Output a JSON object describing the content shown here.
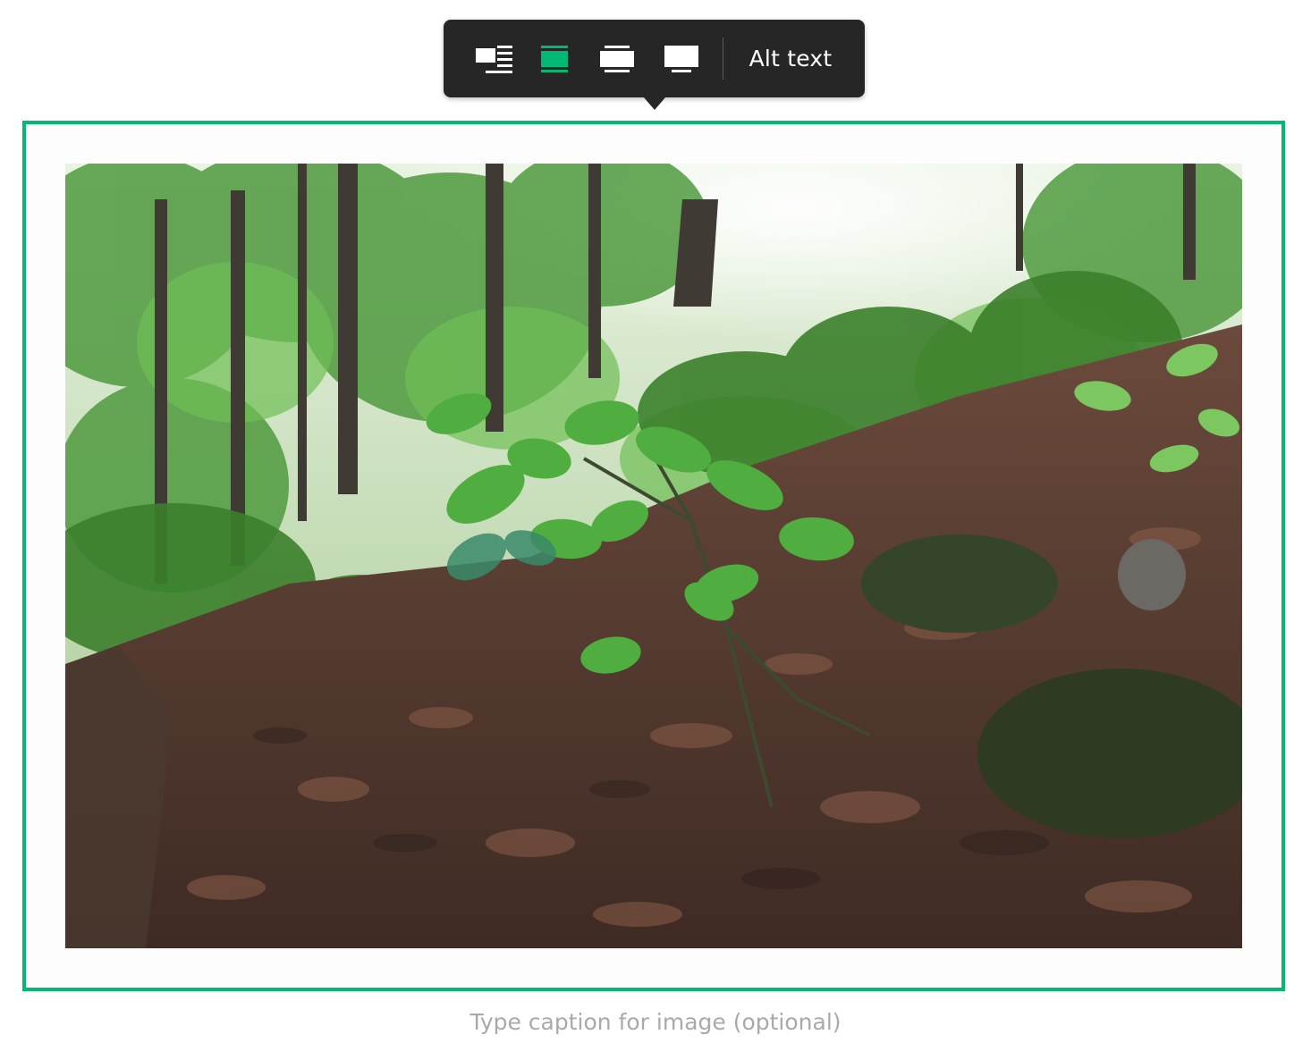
{
  "toolbar": {
    "buttons": [
      {
        "icon": "inset-left-icon",
        "active": false
      },
      {
        "icon": "column-width-icon",
        "active": true
      },
      {
        "icon": "outset-width-icon",
        "active": false
      },
      {
        "icon": "full-width-icon",
        "active": false
      }
    ],
    "alt_text_label": "Alt text"
  },
  "caption": {
    "placeholder": "Type caption for image (optional)"
  },
  "colors": {
    "accent": "#02b875",
    "toolbar_bg": "#262626",
    "icon": "#ffffff",
    "caption": "#a9a9a9"
  },
  "image": {
    "subject": "forest-floor-photo"
  }
}
